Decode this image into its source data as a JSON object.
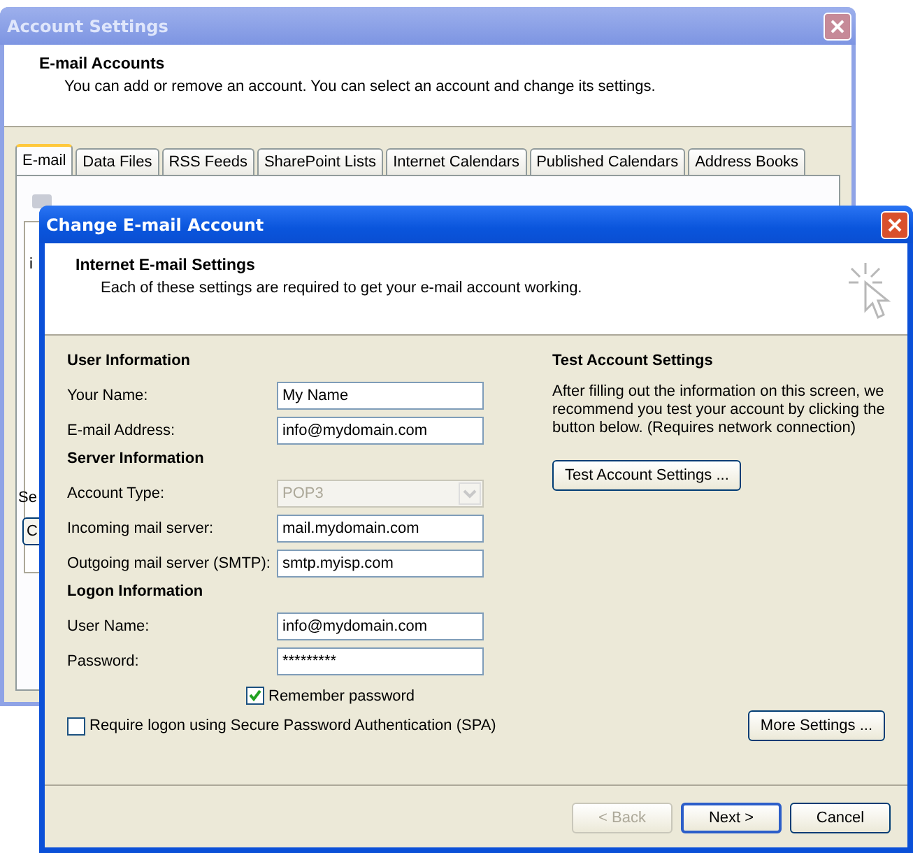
{
  "background_window": {
    "title": "Account Settings",
    "header": {
      "title": "E-mail Accounts",
      "subtitle": "You can add or remove an account. You can select an account and change its settings."
    },
    "tabs": [
      {
        "label": "E-mail",
        "selected": true
      },
      {
        "label": "Data Files",
        "selected": false
      },
      {
        "label": "RSS Feeds",
        "selected": false
      },
      {
        "label": "SharePoint Lists",
        "selected": false
      },
      {
        "label": "Internet Calendars",
        "selected": false
      },
      {
        "label": "Published Calendars",
        "selected": false
      },
      {
        "label": "Address Books",
        "selected": false
      }
    ],
    "list_fragment": "i",
    "label_fragment": "Se",
    "button_fragment": "C"
  },
  "dialog": {
    "title": "Change E-mail Account",
    "header": {
      "title": "Internet E-mail Settings",
      "subtitle": "Each of these settings are required to get your e-mail account working."
    },
    "sections": [
      {
        "heading": "User Information",
        "fields": [
          {
            "kind": "text",
            "label": "Your Name:",
            "value": "My Name",
            "disabled": false
          },
          {
            "kind": "text",
            "label": "E-mail Address:",
            "value": "info@mydomain.com",
            "disabled": false
          }
        ]
      },
      {
        "heading": "Server Information",
        "fields": [
          {
            "kind": "select",
            "label": "Account Type:",
            "value": "POP3",
            "disabled": true
          },
          {
            "kind": "text",
            "label": "Incoming mail server:",
            "value": "mail.mydomain.com",
            "disabled": false
          },
          {
            "kind": "text",
            "label": "Outgoing mail server (SMTP):",
            "value": "smtp.myisp.com",
            "disabled": false
          }
        ]
      },
      {
        "heading": "Logon Information",
        "fields": [
          {
            "kind": "text",
            "label": "User Name:",
            "value": "info@mydomain.com",
            "disabled": false
          },
          {
            "kind": "text",
            "label": "Password:",
            "value": "*********",
            "disabled": false
          }
        ]
      }
    ],
    "remember_password": {
      "label": "Remember password",
      "checked": true
    },
    "spa": {
      "label": "Require logon using Secure Password Authentication (SPA)",
      "checked": false
    },
    "test": {
      "heading": "Test Account Settings",
      "text": "After filling out the information on this screen, we recommend you test your account by clicking the button below. (Requires network connection)",
      "button": "Test Account Settings ..."
    },
    "more_settings": "More Settings ...",
    "buttons": [
      {
        "label": "< Back",
        "disabled": true,
        "default": false
      },
      {
        "label": "Next >",
        "disabled": false,
        "default": true
      },
      {
        "label": "Cancel",
        "disabled": false,
        "default": false
      }
    ]
  }
}
